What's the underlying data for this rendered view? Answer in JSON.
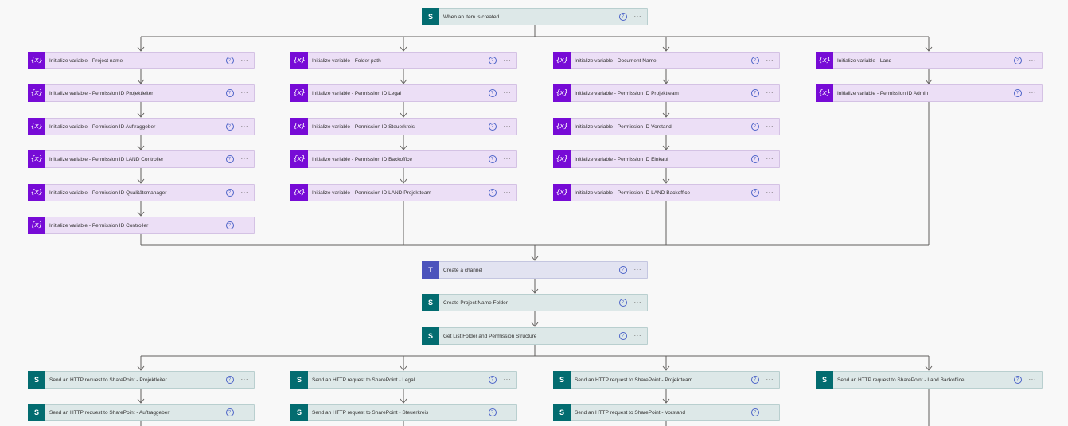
{
  "trigger": {
    "label": "When an item is created",
    "icon": "sharepoint-icon"
  },
  "help_glyph": "?",
  "more_glyph": "···",
  "branches": [
    [
      "Initialize variable - Project name",
      "Initialize variable - Permission ID Projektleiter",
      "Initialize variable - Permission ID Auftraggeber",
      "Initialize variable - Permission ID LAND Controller",
      "Initialize variable - Permission ID Qualitätsmanager",
      "Initialize variable - Permission ID Controller"
    ],
    [
      "Initialize variable - Folder path",
      "Initialize variable - Permission ID Legal",
      "Initialize variable - Permission ID Steuerkreis",
      "Initialize variable - Permission ID Backoffice",
      "Initialize variable - Permission ID LAND Projektteam"
    ],
    [
      "Initialize variable - Document Name",
      "Initialize variable - Permission ID Projektteam",
      "Initialize variable - Permission ID Vorstand",
      "Initialize variable - Permission ID Einkauf",
      "Initialize variable - Permission ID LAND Backoffice"
    ],
    [
      "Initialize variable - Land",
      "Initialize variable - Permission ID Admin"
    ]
  ],
  "middle_steps": [
    {
      "label": "Create a channel",
      "type": "teams"
    },
    {
      "label": "Create Project Name Folder",
      "type": "sp"
    },
    {
      "label": "Get List Folder and Permission Structure",
      "type": "sp"
    }
  ],
  "http_branches": [
    [
      "Send an HTTP request to SharePoint - Projektleiter",
      "Send an HTTP request to SharePoint - Auftraggeber"
    ],
    [
      "Send an HTTP request to SharePoint - Legal",
      "Send an HTTP request to SharePoint - Steuerkreis"
    ],
    [
      "Send an HTTP request to SharePoint - Projektteam",
      "Send an HTTP request to SharePoint - Vorstand"
    ],
    [
      "Send an HTTP request to SharePoint - Land Backoffice"
    ]
  ],
  "colors": {
    "sharepoint": "#036c70",
    "variable": "#770bd6",
    "teams": "#4b53bc",
    "connector": "#605e5c",
    "help": "#4c63c8"
  }
}
